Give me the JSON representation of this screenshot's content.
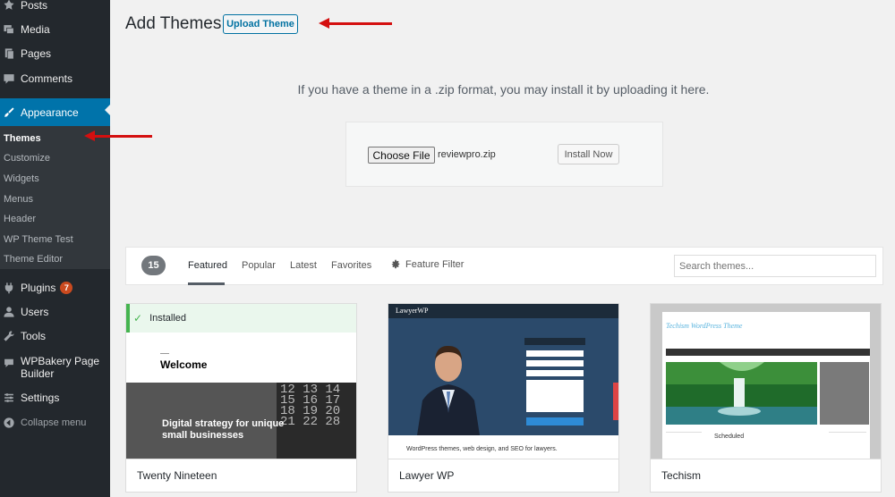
{
  "sidebar": {
    "items": [
      {
        "label": "Posts",
        "icon": "pin-icon"
      },
      {
        "label": "Media",
        "icon": "media-icon"
      },
      {
        "label": "Pages",
        "icon": "pages-icon"
      },
      {
        "label": "Comments",
        "icon": "comment-icon"
      },
      {
        "label": "Appearance",
        "icon": "paintbrush-icon"
      },
      {
        "label": "Plugins",
        "icon": "plugin-icon",
        "badge": "7"
      },
      {
        "label": "Users",
        "icon": "user-icon"
      },
      {
        "label": "Tools",
        "icon": "wrench-icon"
      },
      {
        "label": "WPBakery Page Builder",
        "icon": "wpbakery-icon"
      },
      {
        "label": "Settings",
        "icon": "settings-icon"
      },
      {
        "label": "Collapse menu",
        "icon": "collapse-icon"
      }
    ],
    "submenu": [
      "Themes",
      "Customize",
      "Widgets",
      "Menus",
      "Header",
      "WP Theme Test",
      "Theme Editor"
    ]
  },
  "header": {
    "title": "Add Themes",
    "upload_button": "Upload Theme"
  },
  "upload": {
    "help_text": "If you have a theme in a .zip format, you may install it by uploading it here.",
    "choose_file": "Choose File",
    "file_name": "reviewpro.zip",
    "install_button": "Install Now"
  },
  "filter": {
    "count": "15",
    "tabs": [
      "Featured",
      "Popular",
      "Latest",
      "Favorites"
    ],
    "feature_filter": "Feature Filter",
    "search_placeholder": "Search themes..."
  },
  "themes": [
    {
      "name": "Twenty Nineteen",
      "installed_label": "Installed",
      "preview_welcome": "Welcome",
      "preview_hero": "Digital strategy for unique small businesses",
      "preview_numbers": "12 13 14 15 16 17 18 19 20 21 22 28"
    },
    {
      "name": "Lawyer WP",
      "preview_logo": "LawyerWP",
      "preview_band": "WordPress themes, web design, and SEO for lawyers."
    },
    {
      "name": "Techism",
      "preview_title": "Techism WordPress Theme",
      "preview_scheduled": "Scheduled"
    }
  ],
  "colors": {
    "sidebar_bg": "#23282d",
    "active_menu": "#0073aa",
    "annotation_arrow": "#d40f0f",
    "installed_green": "#46b450"
  }
}
